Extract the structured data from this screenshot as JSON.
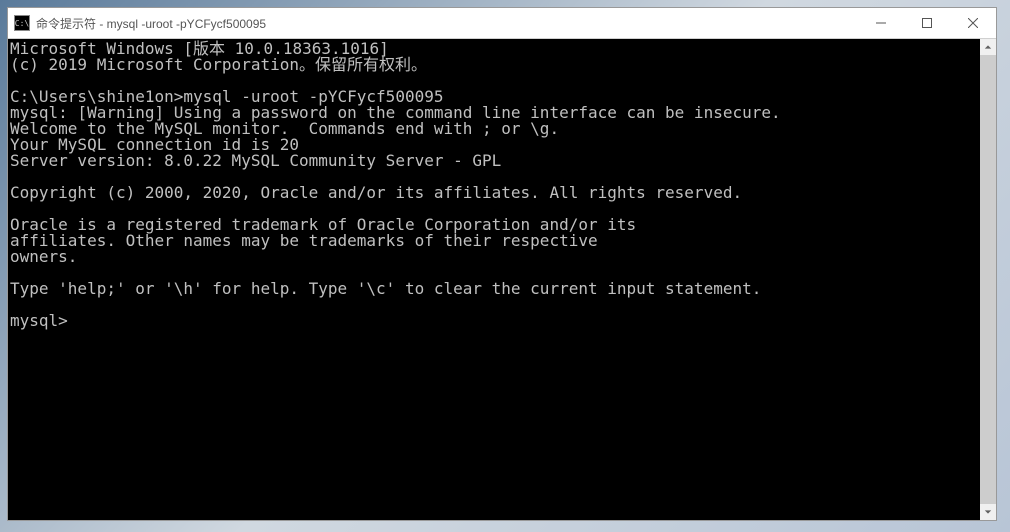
{
  "window": {
    "title": "命令提示符 - mysql  -uroot -pYCFycf500095",
    "icon_label": "C:\\"
  },
  "terminal": {
    "lines": [
      "Microsoft Windows [版本 10.0.18363.1016]",
      "(c) 2019 Microsoft Corporation。保留所有权利。",
      "",
      "C:\\Users\\shine1on>mysql -uroot -pYCFycf500095",
      "mysql: [Warning] Using a password on the command line interface can be insecure.",
      "Welcome to the MySQL monitor.  Commands end with ; or \\g.",
      "Your MySQL connection id is 20",
      "Server version: 8.0.22 MySQL Community Server - GPL",
      "",
      "Copyright (c) 2000, 2020, Oracle and/or its affiliates. All rights reserved.",
      "",
      "Oracle is a registered trademark of Oracle Corporation and/or its",
      "affiliates. Other names may be trademarks of their respective",
      "owners.",
      "",
      "Type 'help;' or '\\h' for help. Type '\\c' to clear the current input statement.",
      "",
      "mysql>"
    ]
  }
}
